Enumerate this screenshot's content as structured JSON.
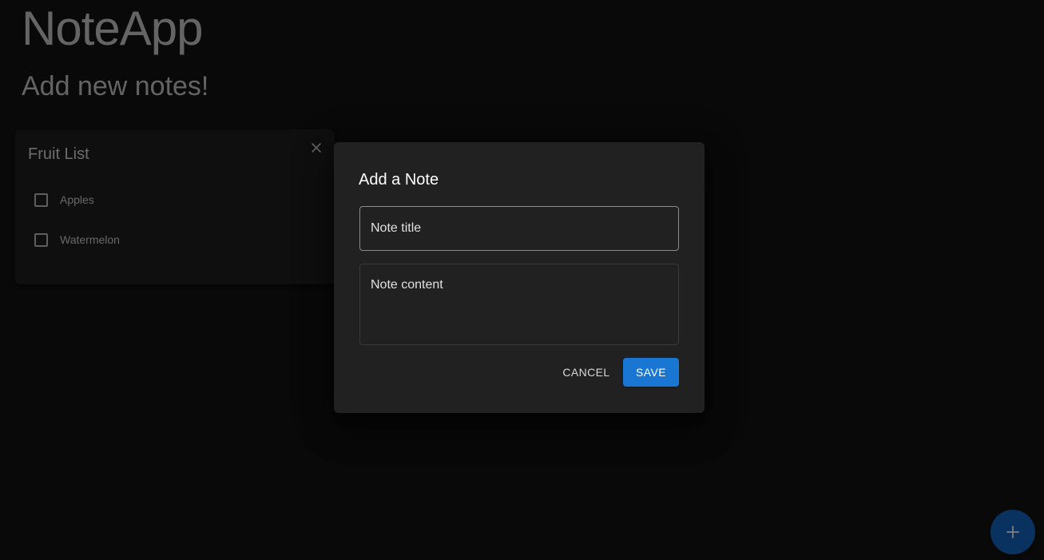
{
  "app": {
    "title": "NoteApp",
    "subtitle": "Add new notes!"
  },
  "note_card": {
    "title": "Fruit List",
    "close_icon": "close-icon",
    "items": [
      {
        "label": "Apples",
        "checked": false
      },
      {
        "label": "Watermelon",
        "checked": false
      }
    ]
  },
  "dialog": {
    "title": "Add a Note",
    "title_field": {
      "placeholder": "Note title",
      "value": ""
    },
    "content_field": {
      "placeholder": "Note content",
      "value": ""
    },
    "cancel_label": "CANCEL",
    "save_label": "SAVE"
  },
  "fab": {
    "icon": "plus-icon"
  },
  "colors": {
    "background": "#121212",
    "card": "#1e1e1e",
    "dialog": "#212121",
    "accent": "#1976d2"
  }
}
